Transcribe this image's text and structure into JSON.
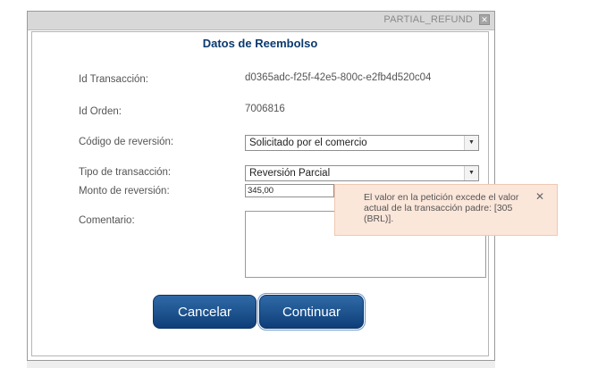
{
  "dialog": {
    "window_title": "PARTIAL_REFUND",
    "close_glyph": "✕",
    "heading": "Datos de Reembolso"
  },
  "form": {
    "transaction_id": {
      "label": "Id Transacción:",
      "value": "d0365adc-f25f-42e5-800c-e2fb4d520c04"
    },
    "order_id": {
      "label": "Id Orden:",
      "value": "7006816"
    },
    "reversal_code": {
      "label": "Código de reversión:",
      "selected": "Solicitado por el comercio"
    },
    "transaction_type": {
      "label": "Tipo de transacción:",
      "selected": "Reversión Parcial"
    },
    "reversal_amount": {
      "label": "Monto de reversión:",
      "value": "345,00"
    },
    "comment": {
      "label": "Comentario:",
      "value": ""
    }
  },
  "tooltip": {
    "message": "El valor en la petición excede el valor actual de la transacción padre: [305 (BRL)].",
    "close_glyph": "✕"
  },
  "buttons": {
    "cancel": "Cancelar",
    "continue": "Continuar"
  },
  "icons": {
    "dropdown_arrow": "▼"
  },
  "colors": {
    "heading": "#0b3a6e",
    "button_top": "#2f6aa6",
    "button_bottom": "#0e3e79",
    "tooltip_bg": "#fbe6da"
  }
}
